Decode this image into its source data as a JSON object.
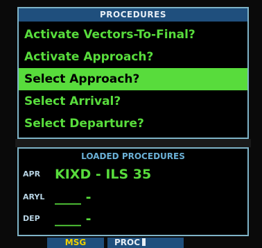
{
  "procedures": {
    "title": "PROCEDURES",
    "items": [
      {
        "label": "Activate Vectors-To-Final?",
        "selected": false
      },
      {
        "label": "Activate Approach?",
        "selected": false
      },
      {
        "label": "Select Approach?",
        "selected": true
      },
      {
        "label": "Select Arrival?",
        "selected": false
      },
      {
        "label": "Select Departure?",
        "selected": false
      }
    ]
  },
  "loaded": {
    "title": "LOADED PROCEDURES",
    "rows": [
      {
        "label": "APR",
        "value": "KIXD - ILS 35"
      },
      {
        "label": "ARYL",
        "value": "____ -"
      },
      {
        "label": "DEP",
        "value": "____ -"
      }
    ]
  },
  "softkeys": {
    "msg": "MSG",
    "proc": "PROC"
  },
  "colors": {
    "accent_green": "#58dc3c",
    "title_blue": "#1f4f7d",
    "border": "#7fb4c8",
    "msg_yellow": "#f0d000"
  }
}
